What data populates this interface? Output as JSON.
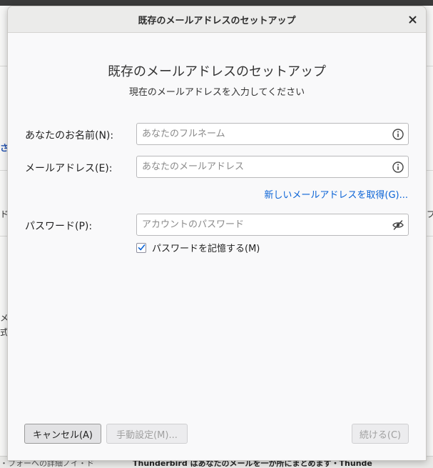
{
  "background": {
    "fragments": [
      "さ",
      "ド",
      "プ",
      "メ",
      "式",
      "・フォーへの詳細ノイ・ド",
      "Thunderbird はあなたのメールを一か所にまとめます・Thunde"
    ]
  },
  "dialog": {
    "title": "既存のメールアドレスのセットアップ",
    "heading": "既存のメールアドレスのセットアップ",
    "subheading": "現在のメールアドレスを入力してください",
    "fields": {
      "name": {
        "label": "あなたのお名前(N):",
        "placeholder": "あなたのフルネーム",
        "value": "",
        "icon": "info-icon"
      },
      "email": {
        "label": "メールアドレス(E):",
        "placeholder": "あなたのメールアドレス",
        "value": "",
        "icon": "info-icon"
      },
      "password": {
        "label": "パスワード(P):",
        "placeholder": "アカウントのパスワード",
        "value": "",
        "icon": "eye-slash-icon"
      }
    },
    "new_address_link": "新しいメールアドレスを取得(G)...",
    "remember_password": {
      "label": "パスワードを記憶する(M)",
      "checked": true
    },
    "buttons": {
      "cancel": "キャンセル(A)",
      "manual": "手動設定(M)...",
      "continue": "続ける(C)"
    }
  },
  "colors": {
    "link": "#0a63d6",
    "accent_check": "#0a63d6",
    "disabled_text": "#a0a0a0"
  }
}
